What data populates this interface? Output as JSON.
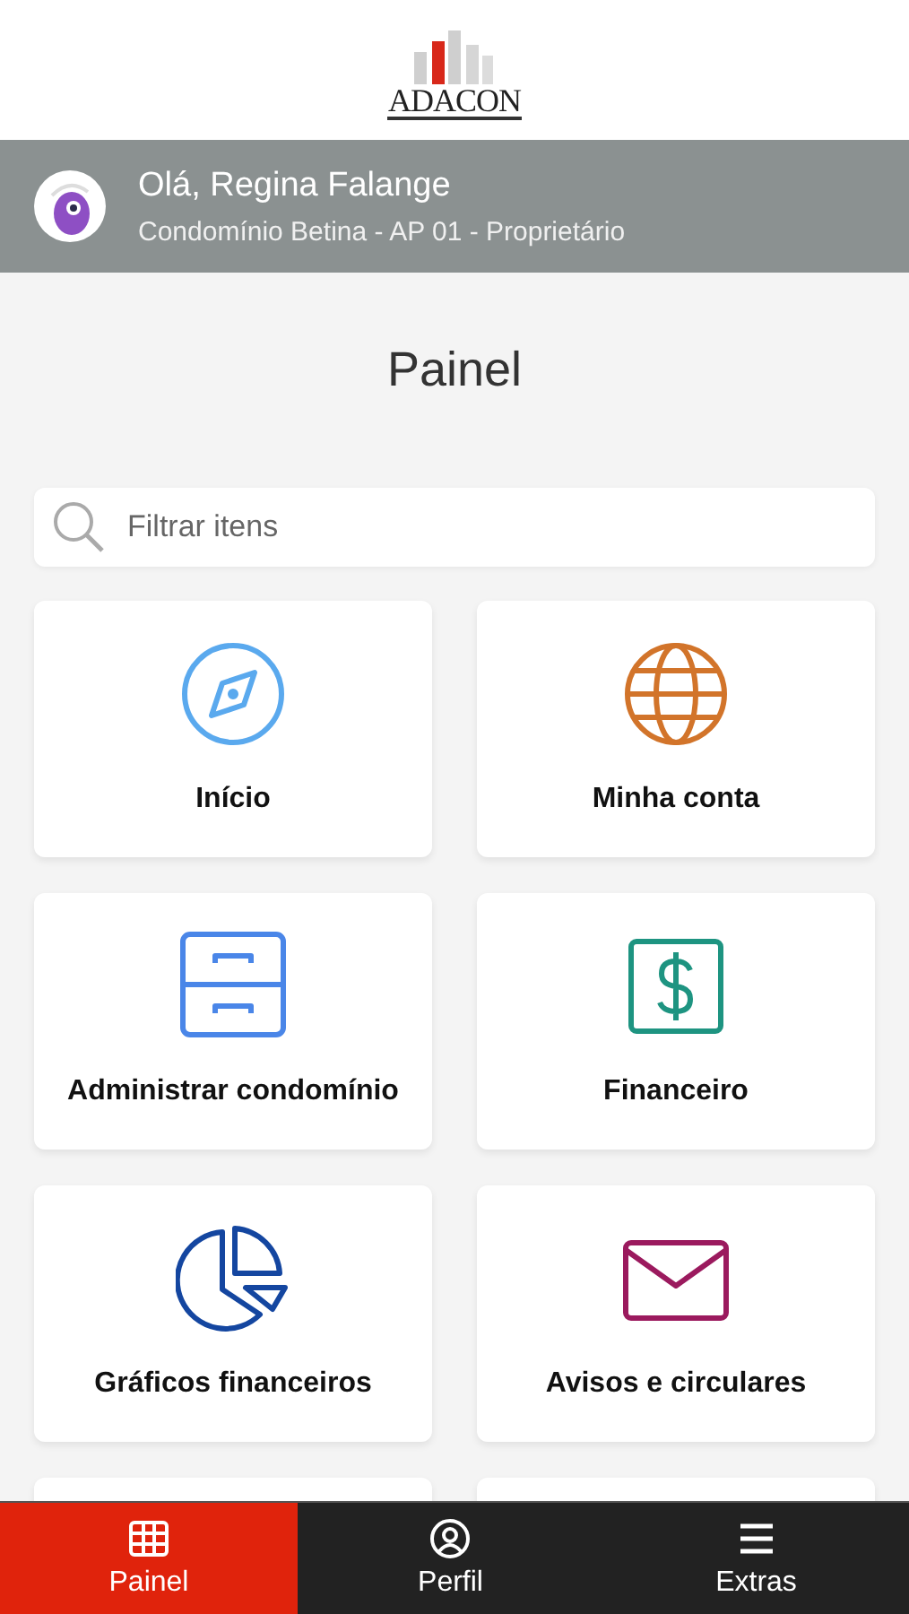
{
  "logo": {
    "text": "ADACON"
  },
  "user": {
    "greeting": "Olá, Regina Falange",
    "subtitle": "Condomínio Betina - AP 01 - Proprietário"
  },
  "title": "Painel",
  "search": {
    "placeholder": "Filtrar itens"
  },
  "tiles": [
    {
      "label": "Início",
      "kind": "compass",
      "color": "#5aa9ee"
    },
    {
      "label": "Minha conta",
      "kind": "globe",
      "color": "#d2742a"
    },
    {
      "label": "Administrar condomínio",
      "kind": "cabinet",
      "color": "#4a86e8"
    },
    {
      "label": "Financeiro",
      "kind": "dollar",
      "color": "#1e9481"
    },
    {
      "label": "Gráficos financeiros",
      "kind": "chart",
      "color": "#1446a0"
    },
    {
      "label": "Avisos e circulares",
      "kind": "mail",
      "color": "#9b1a5e"
    }
  ],
  "tabs": [
    {
      "label": "Painel",
      "kind": "grid",
      "selected": true
    },
    {
      "label": "Perfil",
      "kind": "user",
      "selected": false
    },
    {
      "label": "Extras",
      "kind": "menu",
      "selected": false
    }
  ]
}
